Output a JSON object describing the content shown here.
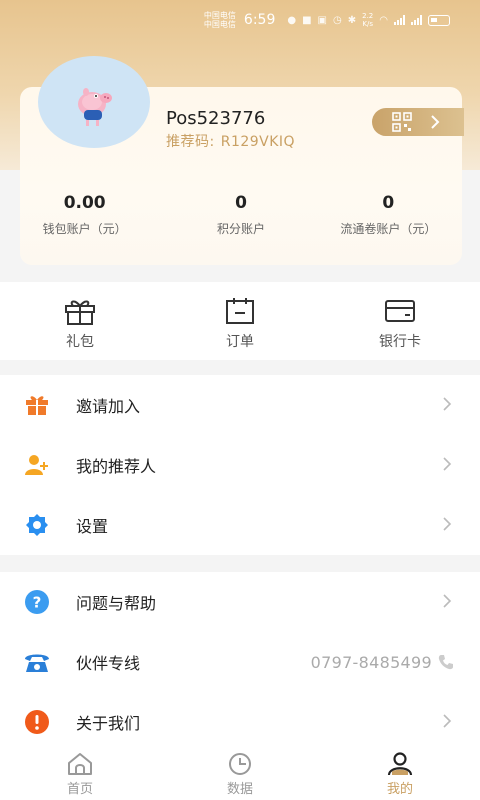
{
  "status_bar": {
    "carrier_1": "中国电信",
    "carrier_2": "中国电信",
    "time": "6:59",
    "speed_value": "2.2",
    "speed_unit": "K/s"
  },
  "profile": {
    "username": "Pos523776",
    "referral_label": "推荐码:",
    "referral_code": "R129VKIQ"
  },
  "accounts": [
    {
      "value": "0.00",
      "label": "钱包账户（元）"
    },
    {
      "value": "0",
      "label": "积分账户"
    },
    {
      "value": "0",
      "label": "流通卷账户（元）"
    }
  ],
  "quick_actions": [
    {
      "label": "礼包",
      "icon": "gift-icon"
    },
    {
      "label": "订单",
      "icon": "order-icon"
    },
    {
      "label": "银行卡",
      "icon": "bank-card-icon"
    }
  ],
  "menu_group_1": [
    {
      "label": "邀请加入",
      "icon": "invite-gift-icon",
      "color": "#f07a2a"
    },
    {
      "label": "我的推荐人",
      "icon": "user-add-icon",
      "color": "#f5a623"
    },
    {
      "label": "设置",
      "icon": "gear-icon",
      "color": "#2a8ff0"
    }
  ],
  "menu_group_2": [
    {
      "label": "问题与帮助",
      "icon": "question-icon",
      "color": "#3b9cf0"
    },
    {
      "label": "伙伴专线",
      "icon": "telephone-icon",
      "color": "#2a7fd8",
      "value": "0797-8485499"
    },
    {
      "label": "关于我们",
      "icon": "alert-icon",
      "color": "#f05a1a"
    }
  ],
  "tabs": [
    {
      "label": "首页",
      "icon": "home-icon",
      "active": false
    },
    {
      "label": "数据",
      "icon": "clock-icon",
      "active": false
    },
    {
      "label": "我的",
      "icon": "user-icon",
      "active": true
    }
  ],
  "colors": {
    "accent_gold": "#c9a063",
    "header_gradient_top": "#e7c48e"
  }
}
